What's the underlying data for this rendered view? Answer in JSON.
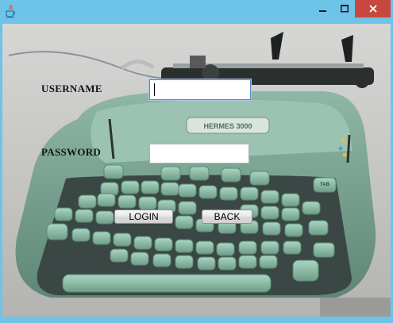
{
  "window": {
    "title": "",
    "controls": [
      "minimize-icon",
      "maximize-icon",
      "close-icon"
    ],
    "titlebar_color": "#6ec3e8",
    "close_color": "#c7483f"
  },
  "form": {
    "username_label": "USERNAME",
    "username_value": "",
    "password_label": "PASSWORD",
    "password_value": "",
    "login_label": "LOGIN",
    "back_label": "BACK"
  },
  "background": {
    "logo_text": "HERMES 3000",
    "key_label": "TAB",
    "machine_color": "#7fa896"
  },
  "icons": {
    "app": "java-icon",
    "minimize": "minimize-icon",
    "maximize": "maximize-icon",
    "close": "close-icon"
  }
}
